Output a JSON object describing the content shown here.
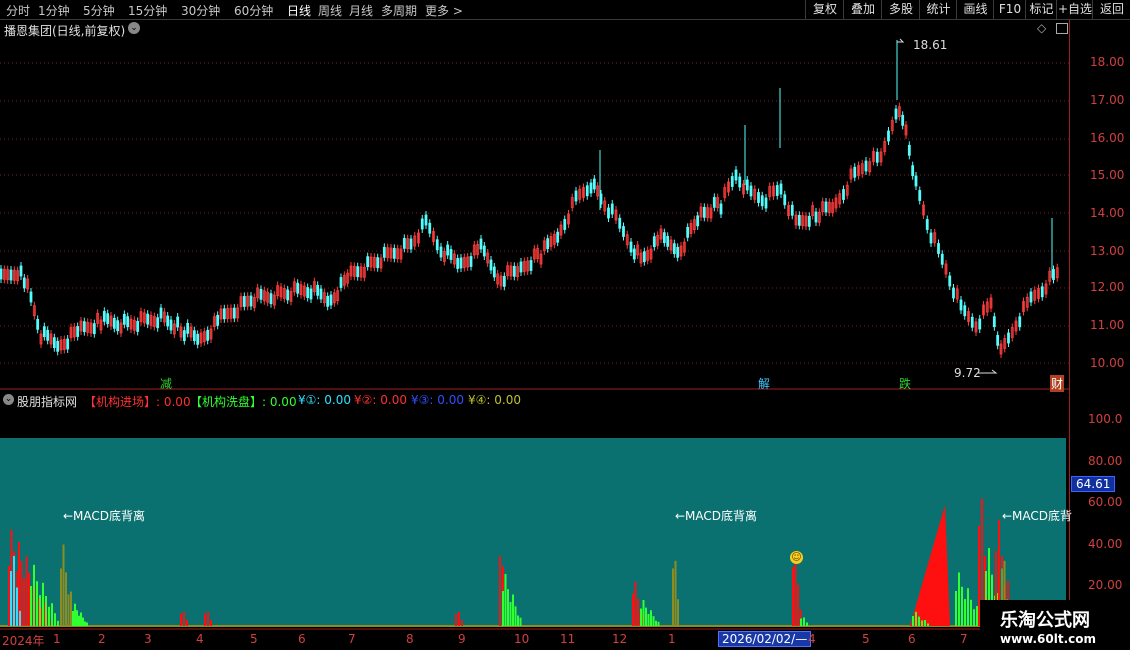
{
  "toolbar": {
    "periods": [
      "分时",
      "1分钟",
      "5分钟",
      "15分钟",
      "30分钟",
      "60分钟",
      "日线",
      "周线",
      "月线",
      "多周期",
      "更多 >"
    ],
    "active_period": "日线",
    "right_buttons": [
      "复权",
      "叠加",
      "多股",
      "统计",
      "画线",
      "F10",
      "标记",
      "+自选",
      "返回"
    ]
  },
  "price_panel": {
    "title": "播恩集团(日线,前复权)",
    "high_label": "18.61",
    "low_label": "9.72",
    "y_ticks": [
      "18.00",
      "17.00",
      "16.00",
      "15.00",
      "14.00",
      "13.00",
      "12.00",
      "11.00",
      "10.00"
    ],
    "markers": [
      {
        "text": "减",
        "color": "#2fd22f"
      },
      {
        "text": "解",
        "color": "#40c8ff"
      },
      {
        "text": "跌",
        "color": "#2fd22f"
      },
      {
        "text": "财",
        "color": "#ffffff"
      }
    ]
  },
  "indicator_panel": {
    "name": "股朋指标网",
    "fields": [
      {
        "label": "【机构进场】: 0.00",
        "color": "#ff3030"
      },
      {
        "label": "【机构洗盘】: 0.00",
        "color": "#30ff30"
      },
      {
        "label": "¥①: 0.00",
        "color": "#30e0ff"
      },
      {
        "label": "¥②: 0.00",
        "color": "#ff3030"
      },
      {
        "label": "¥③: 0.00",
        "color": "#3050ff"
      },
      {
        "label": "¥④: 0.00",
        "color": "#c0c030"
      }
    ],
    "y_ticks": [
      "100.0",
      "80.00",
      "60.00",
      "40.00",
      "20.00"
    ],
    "current_value": "64.61",
    "annotations": [
      "←MACD底背离",
      "←MACD底背离",
      "←MACD底背"
    ]
  },
  "x_axis": {
    "labels": [
      "2024年",
      "1",
      "2",
      "3",
      "4",
      "5",
      "6",
      "7",
      "8",
      "9",
      "10",
      "11",
      "12",
      "1",
      "4",
      "5",
      "6",
      "7"
    ],
    "cursor_date": "2026/02/02/—"
  },
  "watermark": {
    "title": "乐淘公式网",
    "url": "www.60lt.com"
  },
  "colors": {
    "up": "#ff3c3c",
    "down": "#54fcfc",
    "grid": "#7a1c1c",
    "teal_bg": "#0a7070",
    "bar_red": "#ff1010",
    "bar_green": "#30ff30",
    "bar_olive": "#8c8c20"
  }
}
